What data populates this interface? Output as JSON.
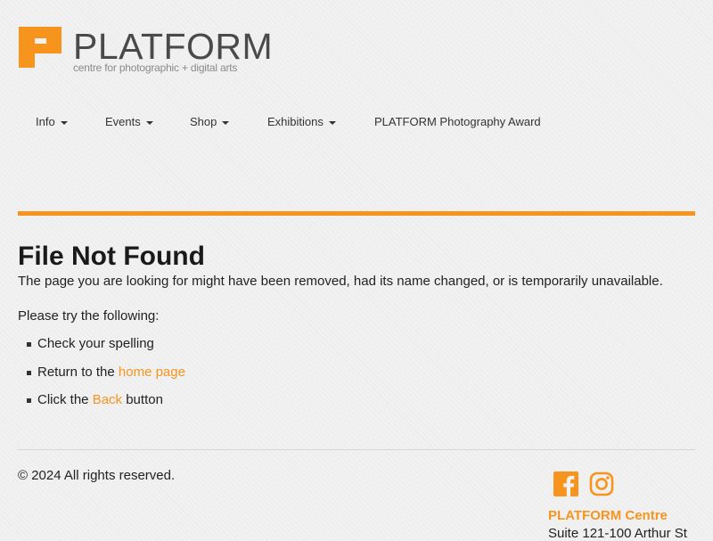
{
  "brand": {
    "name": "PLATFORM",
    "tagline": "centre for photographic + digital arts",
    "accent_color": "#f7941d",
    "logo_icon": "platform-logo-mark"
  },
  "nav": {
    "items": [
      {
        "label": "Info",
        "has_dropdown": true
      },
      {
        "label": "Events",
        "has_dropdown": true
      },
      {
        "label": "Shop",
        "has_dropdown": true
      },
      {
        "label": "Exhibitions",
        "has_dropdown": true
      },
      {
        "label": "PLATFORM Photography Award",
        "has_dropdown": false
      }
    ]
  },
  "main": {
    "title": "File Not Found",
    "lead": "The page you are looking for might have been removed, had its name changed, or is temporarily unavailable.",
    "try_label": "Please try the following:",
    "tips": {
      "spelling": "Check your spelling",
      "return_prefix": "Return to the ",
      "home_link": "home page",
      "click_prefix": "Click the ",
      "back_link": "Back",
      "click_suffix": " button"
    }
  },
  "footer": {
    "copyright": "© 2024 All rights reserved.",
    "social": [
      "facebook-icon",
      "instagram-icon"
    ],
    "org_name": "PLATFORM Centre",
    "address_line": "Suite 121-100 Arthur St"
  }
}
